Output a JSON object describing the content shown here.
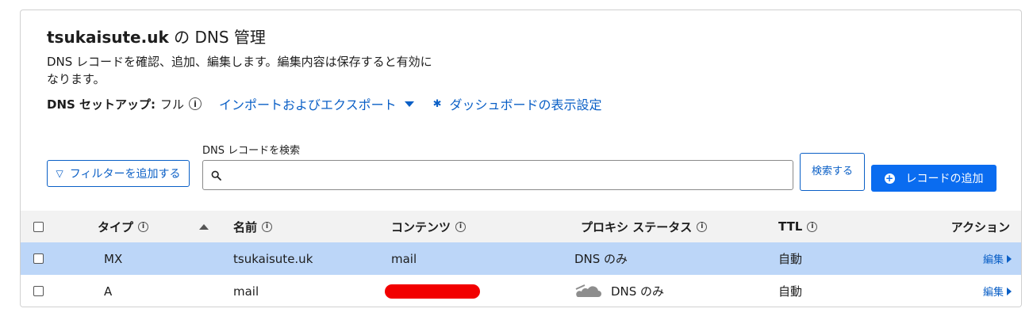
{
  "header": {
    "domain": "tsukaisute.uk",
    "title_suffix": " の DNS 管理",
    "description": "DNS レコードを確認、追加、編集します。編集内容は保存すると有効になります。",
    "setup_label": "DNS セットアップ:",
    "setup_value": "フル",
    "import_export_link": "インポートおよびエクスポート",
    "dashboard_settings_link": "ダッシュボードの表示設定"
  },
  "toolbar": {
    "filter_button": "フィルターを追加する",
    "search_label": "DNS レコードを検索",
    "search_placeholder": "",
    "search_button": "検索する",
    "add_record_button": "レコードの追加"
  },
  "table": {
    "columns": {
      "type": "タイプ",
      "name": "名前",
      "content": "コンテンツ",
      "proxy_status": "プロキシ ステータス",
      "ttl": "TTL",
      "actions": "アクション"
    },
    "rows": [
      {
        "type": "MX",
        "name": "tsukaisute.uk",
        "content": "mail",
        "proxy_status": "DNS のみ",
        "ttl": "自動",
        "action": "編集",
        "selected": true
      },
      {
        "type": "A",
        "name": "mail",
        "content": "",
        "content_redacted": true,
        "proxy_status": "DNS のみ",
        "proxy_icon": "cloud-icon",
        "ttl": "自動",
        "action": "編集",
        "selected": false
      }
    ]
  },
  "colors": {
    "accent": "#0a5fc6",
    "primary_button": "#0a6cf0",
    "selected_row": "#bcd6f8",
    "header_row": "#f2f2f2",
    "redaction": "#f20000"
  }
}
